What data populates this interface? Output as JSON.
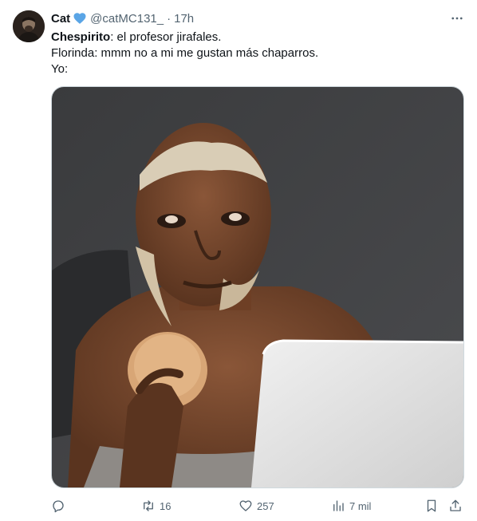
{
  "tweet": {
    "author": {
      "display_name": "Cat",
      "handle": "@catMC131_",
      "verified": true,
      "verified_color": "#5aa5e6"
    },
    "separator": "·",
    "time": "17h",
    "text": {
      "line1_bold": "Chespirito",
      "line1_rest": ": el profesor jirafales.",
      "line2": "Florinda: mmm no a mi me gustan más chaparros.",
      "line3": "Yo:"
    },
    "media": {
      "type": "photo",
      "description_icon": "photo"
    },
    "actions": {
      "reply_count": "",
      "retweet_count": "16",
      "like_count": "257",
      "views_count": "7 mil"
    },
    "icons": {
      "more": "more-icon",
      "reply": "reply-icon",
      "retweet": "retweet-icon",
      "like": "heart-icon",
      "views": "views-icon",
      "bookmark": "bookmark-icon",
      "share": "share-icon"
    },
    "colors": {
      "text": "#0f1419",
      "secondary": "#536471",
      "border": "#cfd9de"
    }
  }
}
